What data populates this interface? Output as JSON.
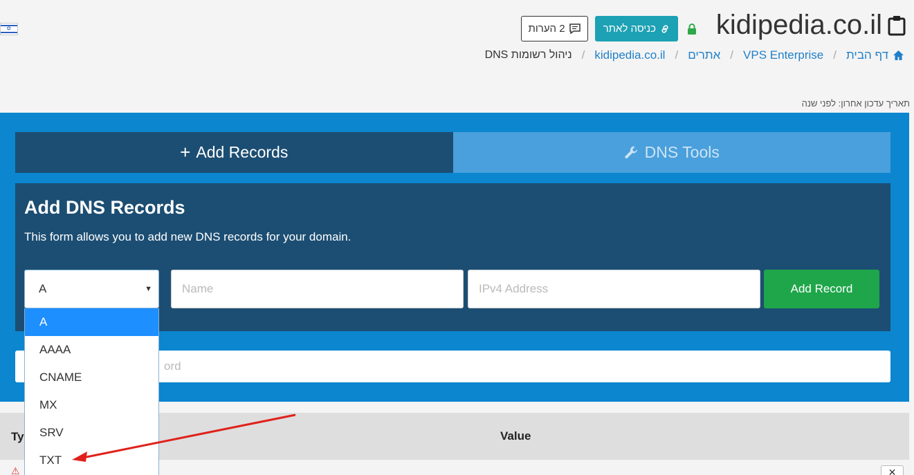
{
  "header": {
    "site_title": "kidipedia.co.il",
    "login_button": "כניסה לאתר",
    "comments_button": "2 הערות"
  },
  "breadcrumb": [
    {
      "label": "דף הבית"
    },
    {
      "label": "VPS Enterprise"
    },
    {
      "label": "אתרים"
    },
    {
      "label": "kidipedia.co.il"
    },
    {
      "label": "ניהול רשומות DNS"
    }
  ],
  "last_updated": "תאריך עדכון אחרון: לפני שנה",
  "tabs": {
    "add_records": "Add Records",
    "dns_tools": "DNS Tools"
  },
  "form": {
    "title": "Add DNS Records",
    "description": "This form allows you to add new DNS records for your domain.",
    "record_type_selected": "A",
    "name_placeholder": "Name",
    "value_placeholder": "IPv4 Address",
    "add_button": "Add Record"
  },
  "search": {
    "placeholder_visible": "ord"
  },
  "dropdown": {
    "options": [
      "A",
      "AAAA",
      "CNAME",
      "MX",
      "SRV",
      "TXT"
    ],
    "selected_index": 0
  },
  "table": {
    "col_type": "Ty",
    "col_value": "Value"
  },
  "colors": {
    "panel_blue": "#0b86cf",
    "dark_navy": "#1c4e73",
    "login_teal": "#1da1b4",
    "add_green": "#1fa64a",
    "selected_blue": "#1e8fff",
    "annotation_red": "#e0211b"
  },
  "icons": {
    "clipboard": "clipboard-icon",
    "lock": "lock-icon",
    "link": "link-icon",
    "comment": "comment-icon",
    "home": "home-icon",
    "wrench": "wrench-icon",
    "plus": "plus-icon"
  }
}
